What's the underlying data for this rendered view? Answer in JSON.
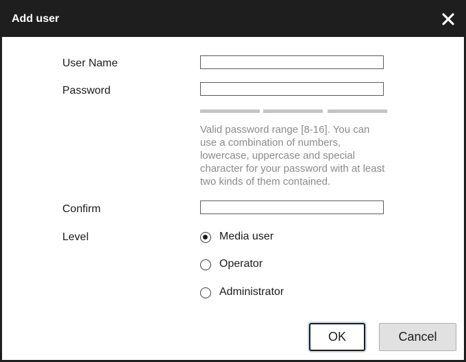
{
  "dialog": {
    "title": "Add user",
    "close_icon": "close-icon"
  },
  "form": {
    "username": {
      "label": "User Name",
      "value": "",
      "placeholder": ""
    },
    "password": {
      "label": "Password",
      "value": "",
      "placeholder": ""
    },
    "password_strength": {
      "segments": 3,
      "filled_segments": 0
    },
    "password_hint": "Valid password range [8-16]. You can use a combination of numbers, lowercase, uppercase and special character for your password with at least two kinds of them contained.",
    "confirm": {
      "label": "Confirm",
      "value": "",
      "placeholder": ""
    },
    "level": {
      "label": "Level",
      "selected": "Media user",
      "options": [
        "Media user",
        "Operator",
        "Administrator"
      ]
    }
  },
  "buttons": {
    "ok_label": "OK",
    "cancel_label": "Cancel"
  },
  "colors": {
    "titlebar": "#1e1e1e",
    "title_text": "#ffffff",
    "hint_text": "#8a8a8a",
    "strength_bar": "#c4c4c4",
    "cancel_button": "#e1e1e1"
  }
}
